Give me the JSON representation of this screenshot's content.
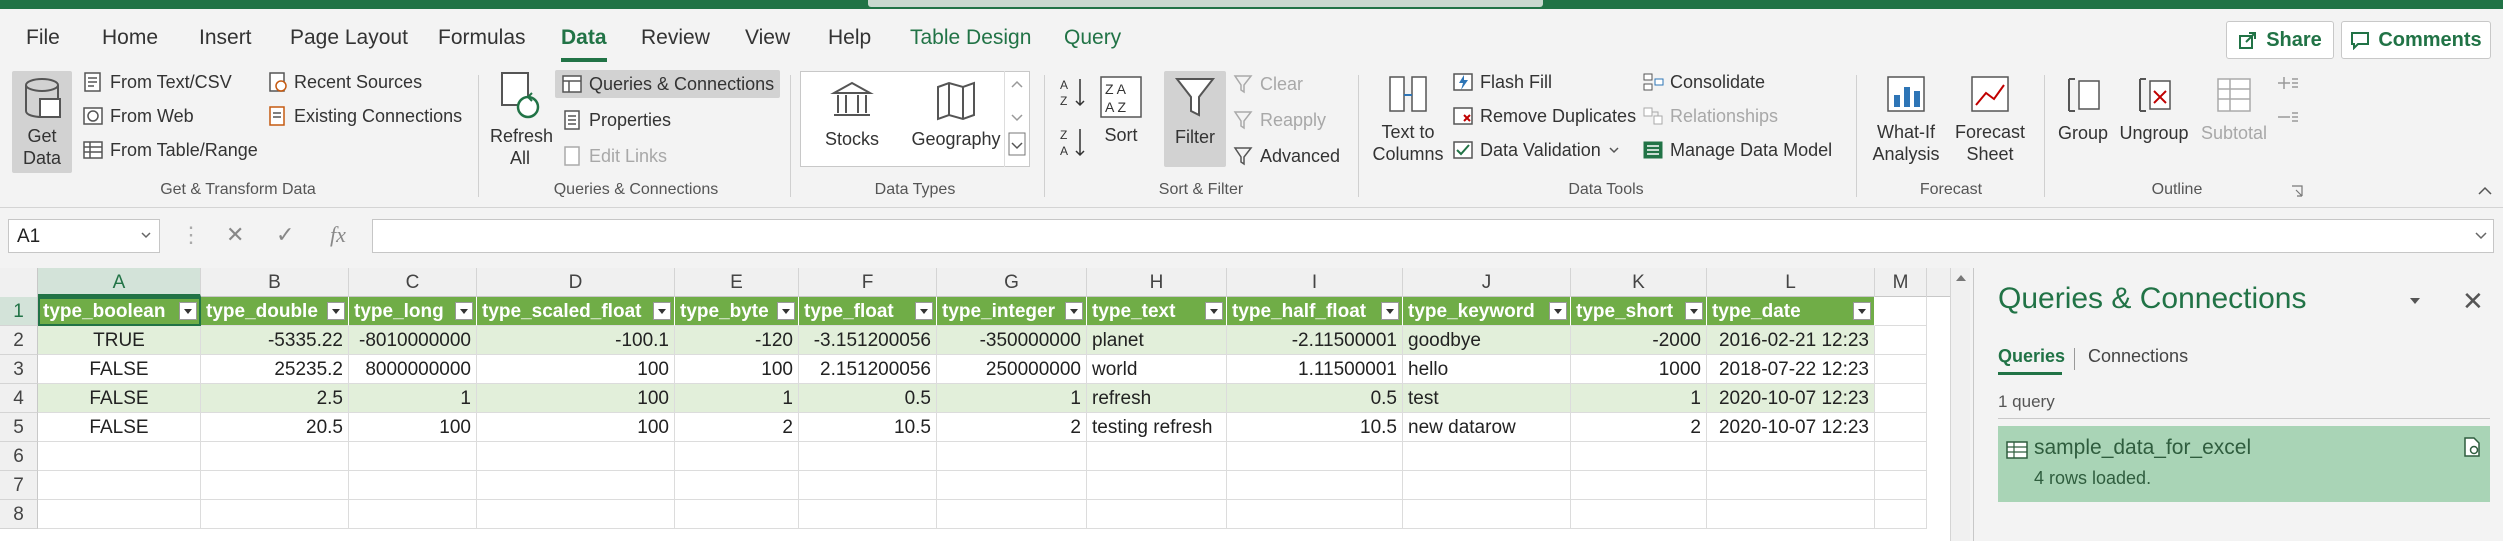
{
  "menu": {
    "tabs": [
      "File",
      "Home",
      "Insert",
      "Page Layout",
      "Formulas",
      "Data",
      "Review",
      "View",
      "Help",
      "Table Design",
      "Query"
    ],
    "share": "Share",
    "comments": "Comments"
  },
  "ribbon": {
    "get_data": "Get Data",
    "from_text_csv": "From Text/CSV",
    "from_web": "From Web",
    "from_table": "From Table/Range",
    "recent_sources": "Recent Sources",
    "existing_connections": "Existing Connections",
    "group_get": "Get & Transform Data",
    "refresh_all": "Refresh All",
    "queries_connections": "Queries & Connections",
    "properties": "Properties",
    "edit_links": "Edit Links",
    "group_queries": "Queries & Connections",
    "stocks": "Stocks",
    "geography": "Geography",
    "group_datatypes": "Data Types",
    "sort": "Sort",
    "filter": "Filter",
    "clear": "Clear",
    "reapply": "Reapply",
    "advanced": "Advanced",
    "group_sort": "Sort & Filter",
    "text_to_columns": "Text to Columns",
    "flash_fill": "Flash Fill",
    "remove_duplicates": "Remove Duplicates",
    "data_validation": "Data Validation",
    "consolidate": "Consolidate",
    "relationships": "Relationships",
    "manage_data_model": "Manage Data Model",
    "group_datatools": "Data Tools",
    "what_if": "What-If Analysis",
    "forecast_sheet": "Forecast Sheet",
    "group_forecast": "Forecast",
    "group": "Group",
    "ungroup": "Ungroup",
    "subtotal": "Subtotal",
    "group_outline": "Outline"
  },
  "formula_bar": {
    "name_box": "A1",
    "fx": "fx",
    "value": ""
  },
  "sheet": {
    "columns": [
      "A",
      "B",
      "C",
      "D",
      "E",
      "F",
      "G",
      "H",
      "I",
      "J",
      "K",
      "L",
      "M"
    ],
    "rows": [
      "1",
      "2",
      "3",
      "4",
      "5",
      "6",
      "7",
      "8"
    ],
    "headers": [
      "type_boolean",
      "type_double",
      "type_long",
      "type_scaled_float",
      "type_byte",
      "type_float",
      "type_integer",
      "type_text",
      "type_half_float",
      "type_keyword",
      "type_short",
      "type_date"
    ],
    "data": [
      [
        "TRUE",
        "-5335.22",
        "-8010000000",
        "-100.1",
        "-120",
        "-3.151200056",
        "-350000000",
        "planet",
        "-2.11500001",
        "goodbye",
        "-2000",
        "2016-02-21 12:23"
      ],
      [
        "FALSE",
        "25235.2",
        "8000000000",
        "100",
        "100",
        "2.151200056",
        "250000000",
        "world",
        "1.11500001",
        "hello",
        "1000",
        "2018-07-22 12:23"
      ],
      [
        "FALSE",
        "2.5",
        "1",
        "100",
        "1",
        "0.5",
        "1",
        "refresh",
        "0.5",
        "test",
        "1",
        "2020-10-07 12:23"
      ],
      [
        "FALSE",
        "20.5",
        "100",
        "100",
        "2",
        "10.5",
        "2",
        "testing refresh",
        "10.5",
        "new datarow",
        "2",
        "2020-10-07 12:23"
      ]
    ]
  },
  "pane": {
    "title": "Queries & Connections",
    "tab_queries": "Queries",
    "tab_connections": "Connections",
    "count": "1 query",
    "query_name": "sample_data_for_excel",
    "query_status": "4 rows loaded."
  }
}
